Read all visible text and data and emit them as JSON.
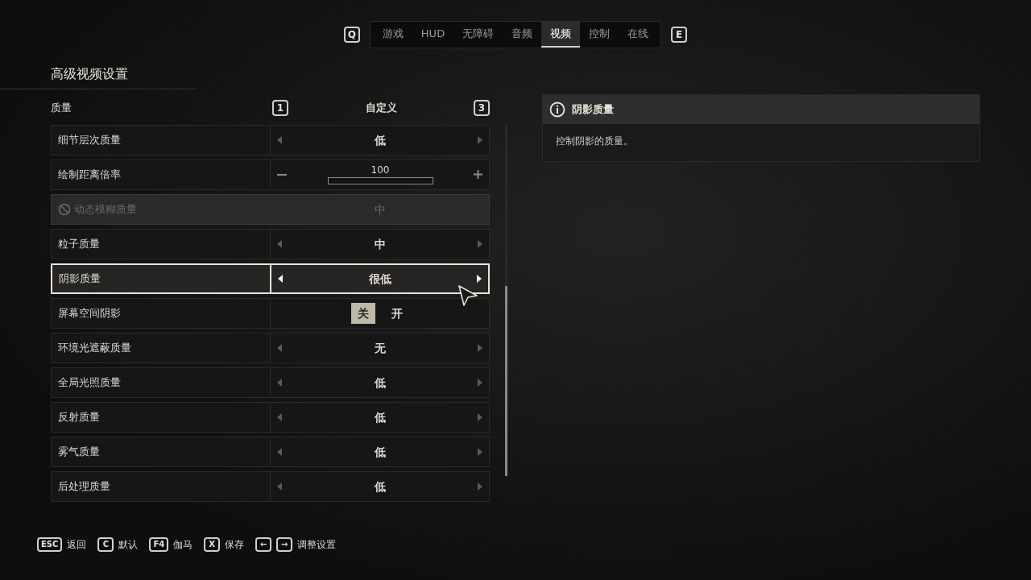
{
  "top_tabs": {
    "prev_key": "Q",
    "next_key": "E",
    "tabs": [
      {
        "label": "游戏",
        "selected": false
      },
      {
        "label": "HUD",
        "selected": false
      },
      {
        "label": "无障碍",
        "selected": false
      },
      {
        "label": "音频",
        "selected": false
      },
      {
        "label": "视频",
        "selected": true
      },
      {
        "label": "控制",
        "selected": false
      },
      {
        "label": "在线",
        "selected": false
      }
    ]
  },
  "section_title": "高级视频设置",
  "preset": {
    "label": "质量",
    "prev_key": "1",
    "value": "自定义",
    "next_key": "3"
  },
  "settings": [
    {
      "kind": "select",
      "label": "细节层次质量",
      "value": "低",
      "disabled": false,
      "selected": false
    },
    {
      "kind": "slider",
      "label": "绘制距离倍率",
      "value": "100",
      "disabled": false,
      "selected": false
    },
    {
      "kind": "select",
      "label": "动态模糊质量",
      "value": "中",
      "disabled": true,
      "selected": false
    },
    {
      "kind": "select",
      "label": "粒子质量",
      "value": "中",
      "disabled": false,
      "selected": false
    },
    {
      "kind": "select",
      "label": "阴影质量",
      "value": "很低",
      "disabled": false,
      "selected": true
    },
    {
      "kind": "toggle",
      "label": "屏幕空间阴影",
      "options": [
        {
          "label": "关",
          "selected": true
        },
        {
          "label": "开",
          "selected": false
        }
      ],
      "disabled": false,
      "selected": false
    },
    {
      "kind": "select",
      "label": "环境光遮蔽质量",
      "value": "无",
      "disabled": false,
      "selected": false
    },
    {
      "kind": "select",
      "label": "全局光照质量",
      "value": "低",
      "disabled": false,
      "selected": false
    },
    {
      "kind": "select",
      "label": "反射质量",
      "value": "低",
      "disabled": false,
      "selected": false
    },
    {
      "kind": "select",
      "label": "雾气质量",
      "value": "低",
      "disabled": false,
      "selected": false
    },
    {
      "kind": "select",
      "label": "后处理质量",
      "value": "低",
      "disabled": false,
      "selected": false
    }
  ],
  "info": {
    "title": "阴影质量",
    "description": "控制阴影的质量。"
  },
  "hints": [
    {
      "keys": [
        "ESC"
      ],
      "label": "返回"
    },
    {
      "keys": [
        "C"
      ],
      "label": "默认"
    },
    {
      "keys": [
        "F4"
      ],
      "label": "伽马"
    },
    {
      "keys": [
        "X"
      ],
      "label": "保存"
    },
    {
      "keys": [
        "←",
        "→"
      ],
      "label": "调整设置"
    }
  ]
}
